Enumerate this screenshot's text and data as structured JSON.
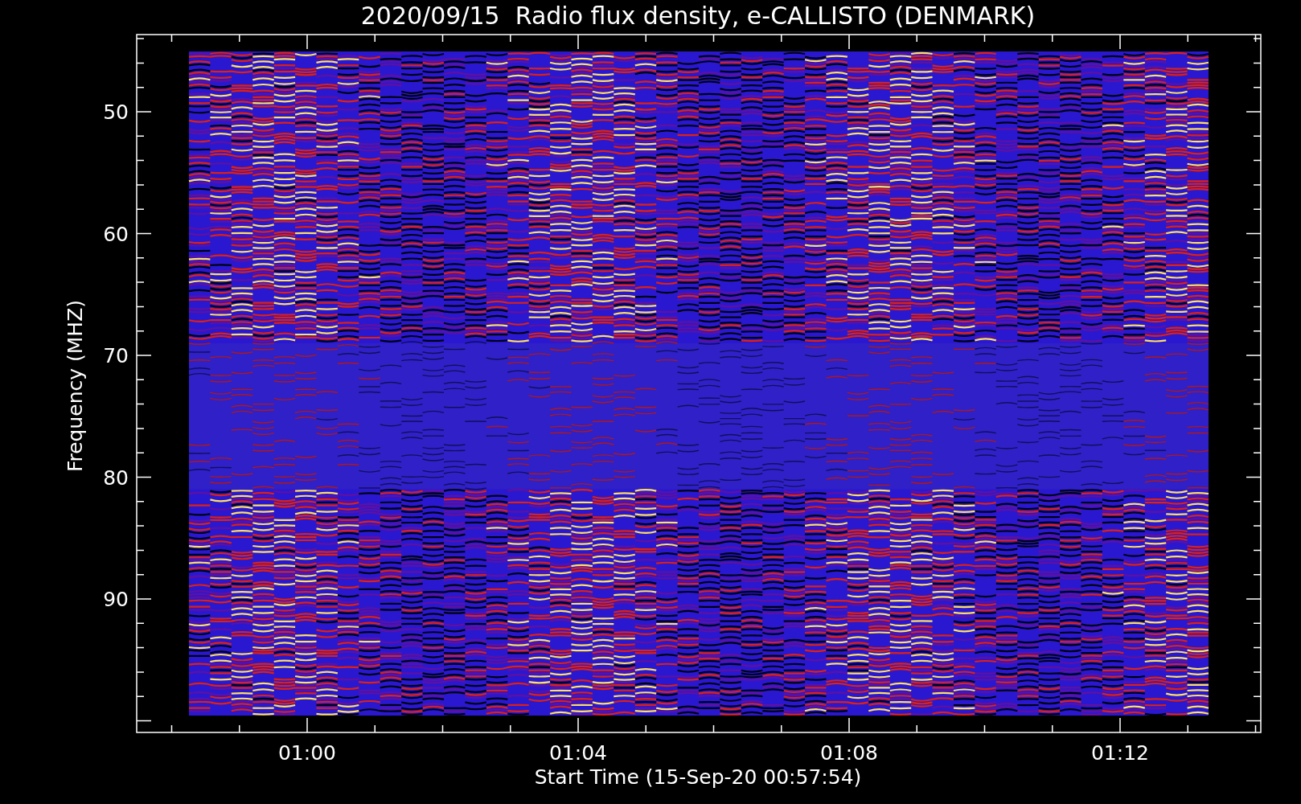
{
  "plot": {
    "title": "2020/09/15  Radio flux density, e-CALLISTO (DENMARK)",
    "ylabel": "Frequency (MHZ)",
    "xlabel": "Start Time (15-Sep-20 00:57:54)",
    "yticks": [
      "50",
      "60",
      "70",
      "80",
      "90"
    ],
    "xticks": [
      "01:00",
      "01:04",
      "01:08",
      "01:12"
    ]
  }
}
